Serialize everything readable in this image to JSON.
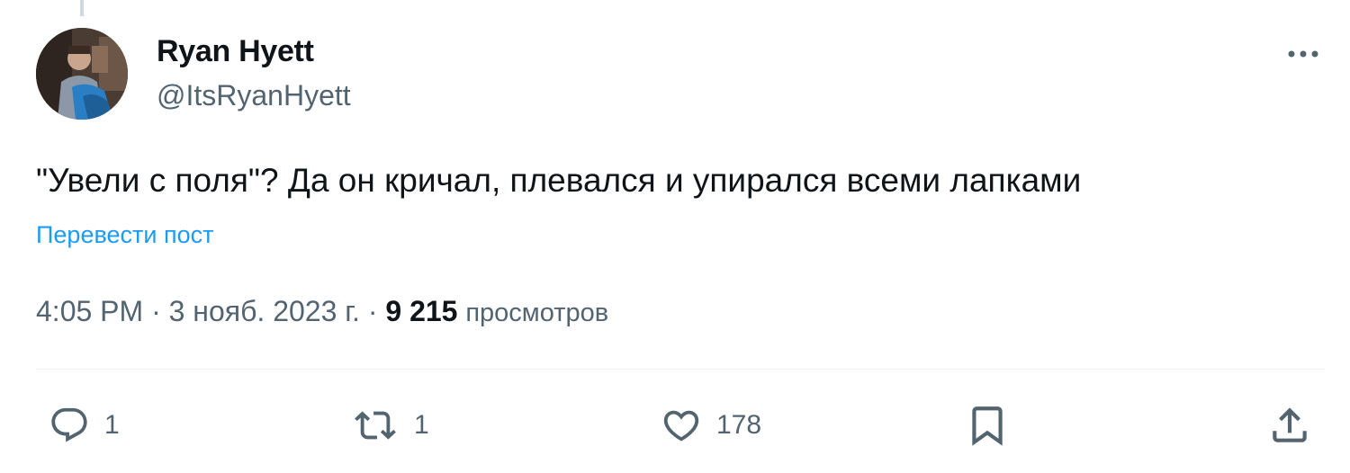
{
  "colors": {
    "text_primary": "#0f1419",
    "text_secondary": "#536471",
    "link": "#1d9bf0",
    "divider": "#eff3f4"
  },
  "author": {
    "display_name": "Ryan Hyett",
    "handle": "@ItsRyanHyett"
  },
  "post": {
    "text": "\"Увели с поля\"? Да он кричал, плевался и упирался всеми лапками",
    "translate_label": "Перевести пост"
  },
  "meta": {
    "time": "4:05 PM",
    "separator": " · ",
    "date": "3 нояб. 2023 г.",
    "views_count": "9 215",
    "views_label": "просмотров"
  },
  "actions": {
    "reply": {
      "icon": "reply-icon",
      "count": "1"
    },
    "repost": {
      "icon": "repost-icon",
      "count": "1"
    },
    "like": {
      "icon": "heart-icon",
      "count": "178"
    },
    "bookmark": {
      "icon": "bookmark-icon"
    },
    "share": {
      "icon": "share-icon"
    }
  }
}
